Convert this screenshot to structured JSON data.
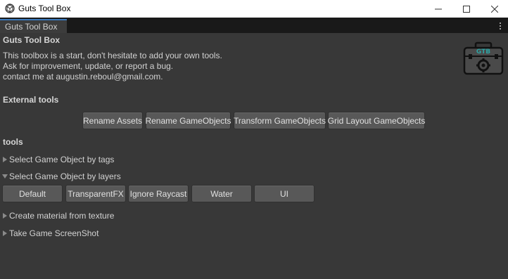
{
  "window": {
    "title": "Guts Tool Box",
    "app_icon": "unity-icon",
    "controls": [
      "minimize-icon",
      "maximize-icon",
      "close-icon"
    ]
  },
  "tabstrip": {
    "tab_label": "Guts Tool Box",
    "menu_icon": "kebab-menu-icon"
  },
  "header": {
    "title": "Guts Tool Box",
    "description_lines": [
      "This toolbox is a start, don't hesitate to add your own tools.",
      "Ask for improvement, update, or report a bug.",
      "contact me at augustin.reboul@gmail.com."
    ],
    "logo_text": "GTB"
  },
  "external_tools": {
    "label": "External tools",
    "buttons": [
      "Rename Assets",
      "Rename GameObjects",
      "Transform GameObjects",
      "Grid Layout GameObjects"
    ]
  },
  "tools": {
    "label": "tools",
    "foldouts": [
      {
        "label": "Select Game Object by tags",
        "expanded": false
      },
      {
        "label": "Select Game Object by layers",
        "expanded": true
      },
      {
        "label": "Create material from texture",
        "expanded": false
      },
      {
        "label": "Take Game ScreenShot",
        "expanded": false
      }
    ],
    "layer_buttons": [
      "Default",
      "TransparentFX",
      "Ignore Raycast",
      "Water",
      "UI"
    ]
  },
  "colors": {
    "background": "#383838",
    "button": "#585858",
    "text": "#d2d2d2",
    "logo_accent": "#2fa3a3"
  }
}
